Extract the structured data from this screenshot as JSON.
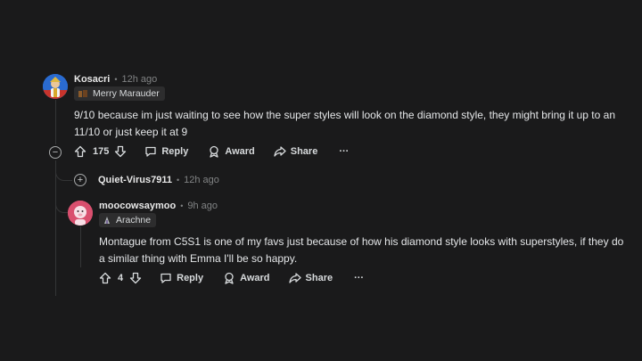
{
  "comments": [
    {
      "username": "Kosacri",
      "time": "12h ago",
      "flair": "Merry Marauder",
      "body": "9/10 because im just waiting to see how the super styles will look on the diamond style, they might bring it up to an 11/10 or just keep it at 9",
      "score": "175",
      "reply_label": "Reply",
      "award_label": "Award",
      "share_label": "Share",
      "more_label": "···"
    },
    {
      "username": "Quiet-Virus7911",
      "time": "12h ago"
    },
    {
      "username": "moocowsaymoo",
      "time": "9h ago",
      "flair": "Arachne",
      "body": "Montague from C5S1 is one of my favs just because of how his diamond style looks with superstyles, if they do a similar thing with Emma I'll be so happy.",
      "score": "4",
      "reply_label": "Reply",
      "award_label": "Award",
      "share_label": "Share",
      "more_label": "···"
    }
  ],
  "colors": {
    "background": "#1a1a1b",
    "thread_line": "#343536",
    "meta": "#818384",
    "text": "#e4e6e8"
  },
  "icons": [
    "collapse-icon",
    "expand-icon",
    "upvote-icon",
    "downvote-icon",
    "reply-icon",
    "award-icon",
    "share-icon",
    "more-icon"
  ]
}
